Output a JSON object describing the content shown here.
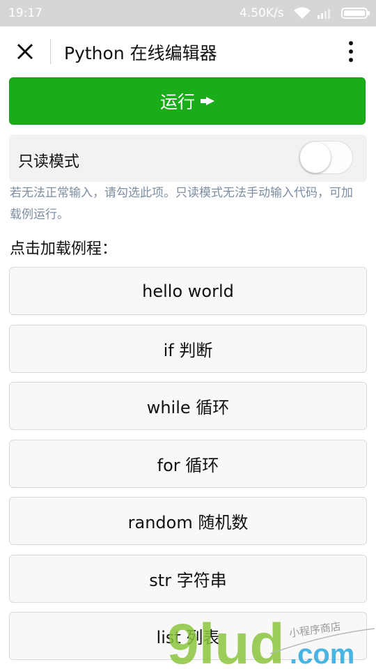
{
  "status_bar": {
    "time": "19:17",
    "network_speed": "4.50K/s"
  },
  "nav": {
    "title": "Python 在线编辑器"
  },
  "run_button": {
    "label": "运行",
    "icon": "play-arrow-icon"
  },
  "readonly": {
    "label": "只读模式",
    "enabled": false,
    "hint": "若无法正常输入，请勾选此项。只读模式无法手动输入代码，可加载例运行。"
  },
  "examples": {
    "section_label": "点击加载例程：",
    "items": [
      {
        "label": "hello world"
      },
      {
        "label": "if 判断"
      },
      {
        "label": "while 循环"
      },
      {
        "label": "for 循环"
      },
      {
        "label": "random 随机数"
      },
      {
        "label": "str 字符串"
      },
      {
        "label": "list 列表"
      }
    ]
  },
  "watermark": {
    "brand": "9lud",
    "suffix": ".com",
    "tagline": "小程序商店"
  },
  "colors": {
    "primary_green": "#1aad19",
    "hint_text": "#7d8ea3",
    "status_bar_bg": "#d6d6d6"
  }
}
